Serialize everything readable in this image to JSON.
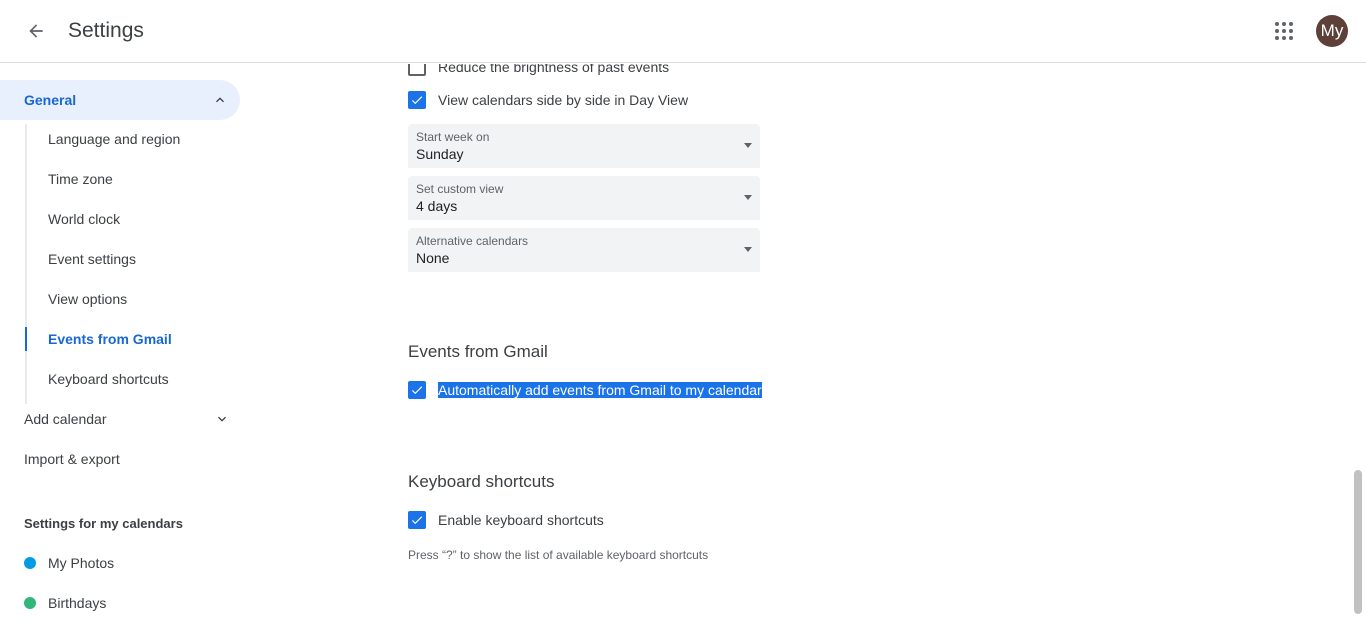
{
  "header": {
    "back_icon": "arrow-back-icon",
    "title": "Settings",
    "apps_icon": "apps-grid-icon",
    "avatar_initials": "My",
    "avatar_color": "#5d4037"
  },
  "sidebar": {
    "general": {
      "label": "General",
      "expanded": true
    },
    "general_items": [
      {
        "label": "Language and region"
      },
      {
        "label": "Time zone"
      },
      {
        "label": "World clock"
      },
      {
        "label": "Event settings"
      },
      {
        "label": "View options"
      },
      {
        "label": "Events from Gmail",
        "active": true
      },
      {
        "label": "Keyboard shortcuts"
      }
    ],
    "add_calendar": "Add calendar",
    "import_export": "Import & export",
    "my_calendars_title": "Settings for my calendars",
    "calendars": [
      {
        "label": "My Photos",
        "color": "#039be5"
      },
      {
        "label": "Birthdays",
        "color": "#33b679"
      }
    ]
  },
  "main": {
    "reduce_brightness": {
      "label": "Reduce the brightness of past events",
      "checked": false
    },
    "side_by_side": {
      "label": "View calendars side by side in Day View",
      "checked": true
    },
    "start_week": {
      "label": "Start week on",
      "value": "Sunday"
    },
    "custom_view": {
      "label": "Set custom view",
      "value": "4 days"
    },
    "alt_calendars": {
      "label": "Alternative calendars",
      "value": "None"
    },
    "gmail_heading": "Events from Gmail",
    "gmail_auto": {
      "label": "Automatically add events from Gmail to my calendar",
      "checked": true,
      "selected": true
    },
    "shortcuts_heading": "Keyboard shortcuts",
    "shortcuts_enable": {
      "label": "Enable keyboard shortcuts",
      "checked": true
    },
    "shortcuts_hint": "Press “?” to show the list of available keyboard shortcuts"
  },
  "colors": {
    "accent": "#1a73e8",
    "active_text": "#1967d2",
    "active_bg": "#e8f0fe"
  }
}
